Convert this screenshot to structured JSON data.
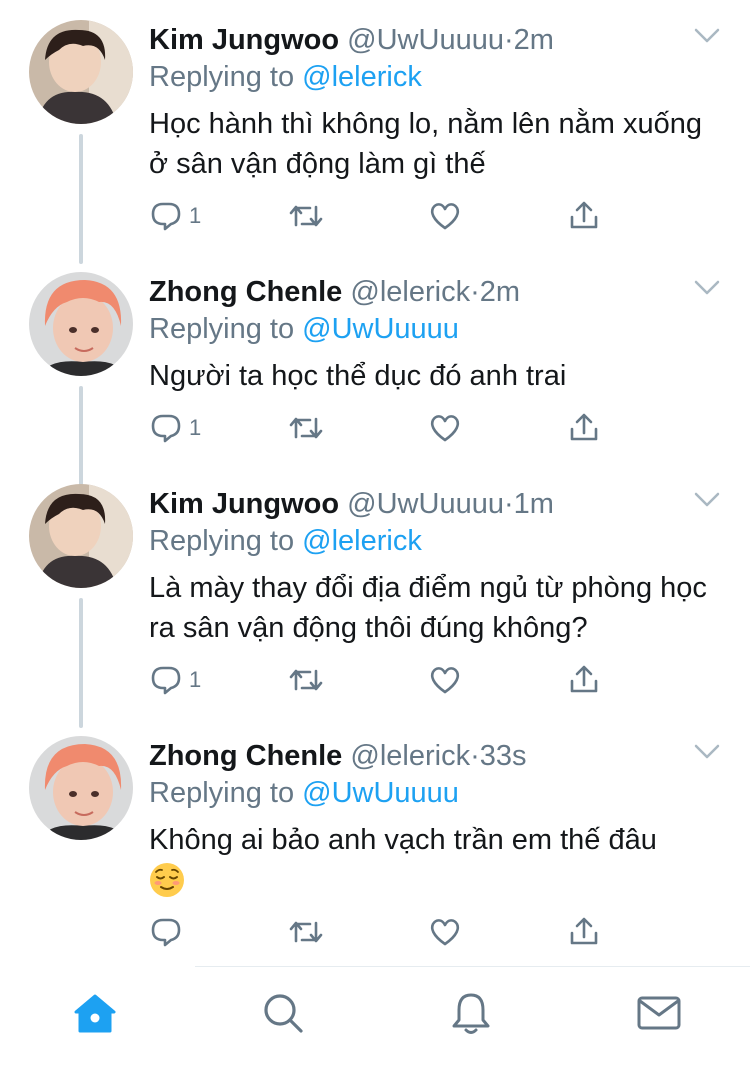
{
  "colors": {
    "link": "#1da1f2",
    "secondary_text": "#657786",
    "primary_text": "#14171a",
    "thread_line": "#ccd6dd",
    "tab_active": "#1da1f2",
    "tab_inactive": "#657786"
  },
  "tweets": [
    {
      "name": "Kim Jungwoo",
      "handle": "@UwUuuuu",
      "separator": "·",
      "time": "2m",
      "replying_label": "Replying to",
      "replying_to": "@lelerick",
      "text": "Học hành thì không lo, nằm lên nằm xuống ở sân vận động làm gì thế",
      "reply_count": "1",
      "avatar_icon": "avatar-photo"
    },
    {
      "name": "Zhong Chenle",
      "handle": "@lelerick",
      "separator": "·",
      "time": "2m",
      "replying_label": "Replying to",
      "replying_to": "@UwUuuuu",
      "text": "Người ta học thể dục đó anh trai",
      "reply_count": "1",
      "avatar_icon": "avatar-photo"
    },
    {
      "name": "Kim Jungwoo",
      "handle": "@UwUuuuu",
      "separator": "·",
      "time": "1m",
      "replying_label": "Replying to",
      "replying_to": "@lelerick",
      "text": "Là mày thay đổi địa điểm ngủ từ phòng học ra sân vận động thôi đúng không?",
      "reply_count": "1",
      "avatar_icon": "avatar-photo"
    },
    {
      "name": "Zhong Chenle",
      "handle": "@lelerick",
      "separator": "·",
      "time": "33s",
      "replying_label": "Replying to",
      "replying_to": "@UwUuuuu",
      "text": "Không ai bảo anh vạch trần em thế đâu",
      "emoji": "relieved-face-emoji",
      "reply_count": "",
      "avatar_icon": "avatar-photo"
    }
  ],
  "tabbar": {
    "items": [
      {
        "icon": "home-icon",
        "active": true
      },
      {
        "icon": "search-icon",
        "active": false
      },
      {
        "icon": "notifications-bell-icon",
        "active": false
      },
      {
        "icon": "messages-envelope-icon",
        "active": false
      }
    ]
  }
}
